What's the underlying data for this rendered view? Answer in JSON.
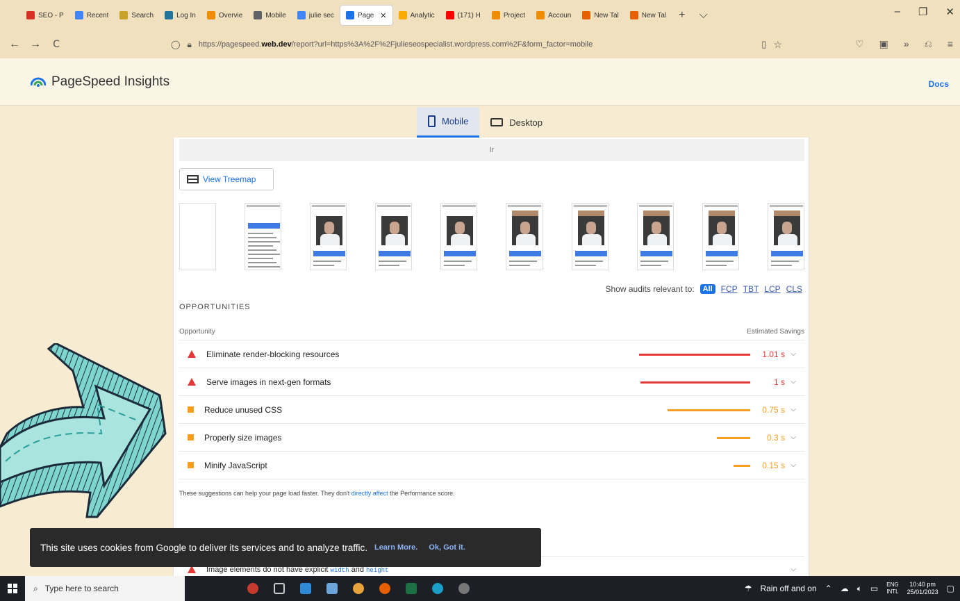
{
  "browser": {
    "tabs": [
      {
        "label": "SEO - P",
        "icon": "gmail-icon",
        "color": "#d93025"
      },
      {
        "label": "Recent",
        "icon": "google-icon",
        "color": "#4285f4"
      },
      {
        "label": "Search",
        "icon": "search-site-icon",
        "color": "#c9a227"
      },
      {
        "label": "Log In",
        "icon": "wordpress-icon",
        "color": "#21759b"
      },
      {
        "label": "Overvie",
        "icon": "ahrefs-icon",
        "color": "#f08c00"
      },
      {
        "label": "Mobile",
        "icon": "mobile-test-icon",
        "color": "#5f6368"
      },
      {
        "label": "julie sec",
        "icon": "google-icon",
        "color": "#4285f4"
      },
      {
        "label": "Page",
        "icon": "pagespeed-icon",
        "color": "#1a73e8",
        "active": true
      },
      {
        "label": "Analytic",
        "icon": "analytics-icon",
        "color": "#f9ab00"
      },
      {
        "label": "(171) H",
        "icon": "youtube-icon",
        "color": "#ff0000"
      },
      {
        "label": "Project",
        "icon": "ahrefs-icon",
        "color": "#f08c00"
      },
      {
        "label": "Accoun",
        "icon": "ahrefs-icon",
        "color": "#f08c00"
      },
      {
        "label": "New Tal",
        "icon": "firefox-icon",
        "color": "#e66000"
      },
      {
        "label": "New Tal",
        "icon": "firefox-icon",
        "color": "#e66000"
      }
    ],
    "new_tab_symbol": "+",
    "tab_list_symbol": "⌵",
    "close_symbol": "✕",
    "window_controls": [
      "–",
      "❐",
      "✕"
    ],
    "nav": {
      "back": "←",
      "forward": "→",
      "reload": "C"
    },
    "url_prefix": "https://pagespeed.",
    "url_domain": "web.dev",
    "url_rest": "/report?url=https%3A%2F%2Fjulieseospecialist.wordpress.com%2F&form_factor=mobile",
    "url_icons": [
      "▯",
      "☆"
    ],
    "toolbar_icons": [
      "♡",
      "▣",
      "»",
      "⎌",
      "≡"
    ]
  },
  "psi": {
    "title": "PageSpeed Insights",
    "docs": "Docs",
    "tabs": {
      "mobile": "Mobile",
      "desktop": "Desktop"
    },
    "grey_strip_text": "Ir",
    "view_treemap": "View Treemap",
    "filmstrip_frames": 10,
    "audit_filter": {
      "label": "Show audits relevant to:",
      "all": "All",
      "metrics": [
        "FCP",
        "TBT",
        "LCP",
        "CLS"
      ]
    },
    "opportunities": {
      "title": "OPPORTUNITIES",
      "col_left": "Opportunity",
      "col_right": "Estimated Savings",
      "items": [
        {
          "title": "Eliminate render-blocking resources",
          "saving": "1.01 s",
          "seconds": 1.01,
          "level": "fail"
        },
        {
          "title": "Serve images in next-gen formats",
          "saving": "1 s",
          "seconds": 1.0,
          "level": "fail"
        },
        {
          "title": "Reduce unused CSS",
          "saving": "0.75 s",
          "seconds": 0.75,
          "level": "average"
        },
        {
          "title": "Properly size images",
          "saving": "0.3 s",
          "seconds": 0.3,
          "level": "average"
        },
        {
          "title": "Minify JavaScript",
          "saving": "0.15 s",
          "seconds": 0.15,
          "level": "average"
        }
      ],
      "note_before": "These suggestions can help your page load faster. They don't ",
      "note_link": "directly affect",
      "note_after": " the Performance score."
    },
    "diagnostic": {
      "before": "Image elements do not have explicit ",
      "code1": "width",
      "and": " and ",
      "code2": "height"
    },
    "colors": {
      "fail": "#e53935",
      "average": "#fb9e22",
      "accent": "#1a73e8"
    }
  },
  "cookie": {
    "text": "This site uses cookies from Google to deliver its services and to analyze traffic.",
    "learn_more": "Learn More.",
    "ok": "Ok, Got it."
  },
  "taskbar": {
    "search_placeholder": "Type here to search",
    "weather": "Rain off and on",
    "lang_top": "ENG",
    "lang_bottom": "INTL",
    "time": "10:40 pm",
    "date": "25/01/2023"
  }
}
